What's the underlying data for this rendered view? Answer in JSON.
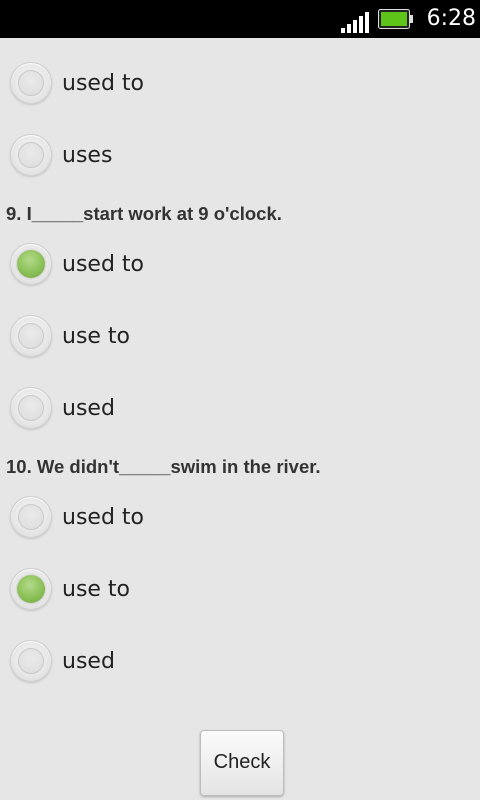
{
  "status_bar": {
    "time": "6:28",
    "signal_icon": "signal-bars-icon",
    "battery_icon": "battery-full-icon",
    "battery_color": "#5fc41a"
  },
  "prev_question": {
    "options": [
      {
        "label": "used to",
        "selected": false
      },
      {
        "label": "uses",
        "selected": false
      }
    ]
  },
  "question_9": {
    "text": "9. I_____start work at 9 o'clock.",
    "options": [
      {
        "label": "used to",
        "selected": true
      },
      {
        "label": "use to",
        "selected": false
      },
      {
        "label": "used",
        "selected": false
      }
    ]
  },
  "question_10": {
    "text": "10. We didn't_____swim in the river.",
    "options": [
      {
        "label": "used to",
        "selected": false
      },
      {
        "label": "use to",
        "selected": true
      },
      {
        "label": "used",
        "selected": false
      }
    ]
  },
  "check_label": "Check",
  "accent_color": "#8fc35c"
}
